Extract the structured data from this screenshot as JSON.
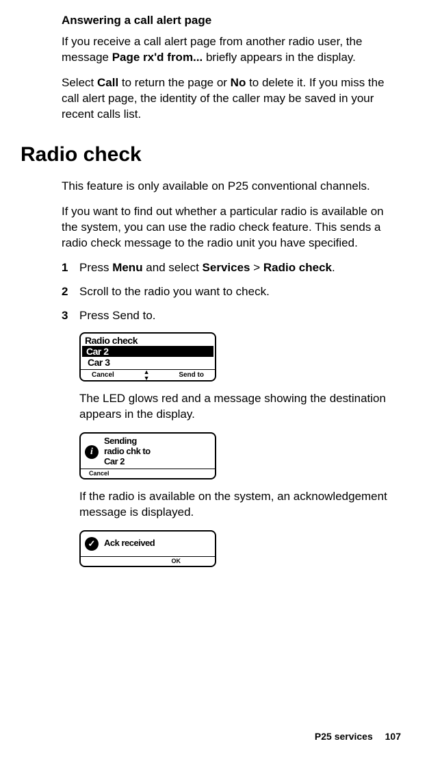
{
  "subheading1": "Answering a call alert page",
  "para1_pre": "If you receive a call alert page from another radio user, the message ",
  "para1_bold": "Page rx'd from...",
  "para1_post": " briefly appears in the display.",
  "para2_a": "Select ",
  "para2_b1": "Call",
  "para2_c": " to return the page or ",
  "para2_b2": "No",
  "para2_d": " to delete it. If you miss the call alert page, the identity of the caller may be saved in your recent calls list.",
  "mainheading": "Radio check",
  "para3": "This feature is only available on P25 conventional channels.",
  "para4": "If you want to find out whether a particular radio is available on the system, you can use the radio check feature. This sends a radio check message to the radio unit you have specified.",
  "step1_num": "1",
  "step1_a": "Press ",
  "step1_b1": "Menu",
  "step1_c": " and select ",
  "step1_b2": "Services",
  "step1_d": " > ",
  "step1_b3": "Radio check",
  "step1_e": ".",
  "step2_num": "2",
  "step2_txt": "Scroll to the radio you want to check.",
  "step3_num": "3",
  "step3_txt": "Press Send to.",
  "screen1": {
    "title": "Radio check",
    "selected": "Car 2",
    "option": "Car 3",
    "left": "Cancel",
    "right": "Send to"
  },
  "result1": "The LED glows red and a message showing the destination appears in the display.",
  "screen2": {
    "line1": "Sending",
    "line2": "radio chk to",
    "line3": "Car 2",
    "left": "Cancel"
  },
  "result2": "If the radio is available on the system, an acknowledgement message is displayed.",
  "screen3": {
    "text": "Ack received",
    "right": "OK"
  },
  "footer": {
    "section": "P25 services",
    "page": "107"
  }
}
